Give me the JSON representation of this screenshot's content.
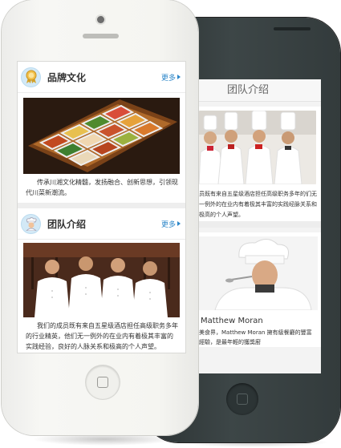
{
  "front_phone": {
    "brand_card": {
      "title": "品牌文化",
      "more_label": "更多",
      "description": "传承川湘文化精髓，发扬融合、创新思想，引领现代川菜新潮流。"
    },
    "team_card": {
      "title": "团队介绍",
      "more_label": "更多",
      "description": "我们的成员既有来自五星级酒店担任高级职务多年的行业精英，他们无一例外的在业内有着极其丰富的实践经验，良好的人脉关系和极高的个人声望。"
    }
  },
  "back_phone": {
    "header_title": "团队介绍",
    "team_excerpt": "员既有来自五星级酒店担任高级职务多年的们无一例外的在业内有着极其丰富的实践经脉关系和极高的个人声望。",
    "chef_name": "Matthew Moran",
    "chef_bio": "美食界，Matthew Moran 擁有級餐廳的豐富經驗，是最年輕的獲獎廚"
  },
  "colors": {
    "accent_blue": "#2b86c9",
    "dark_phone_body": "#353d3e",
    "white_phone_body": "#f5f5f1"
  },
  "icons": [
    "award-ribbon-icon",
    "chef-icon",
    "arrow-right-icon"
  ]
}
